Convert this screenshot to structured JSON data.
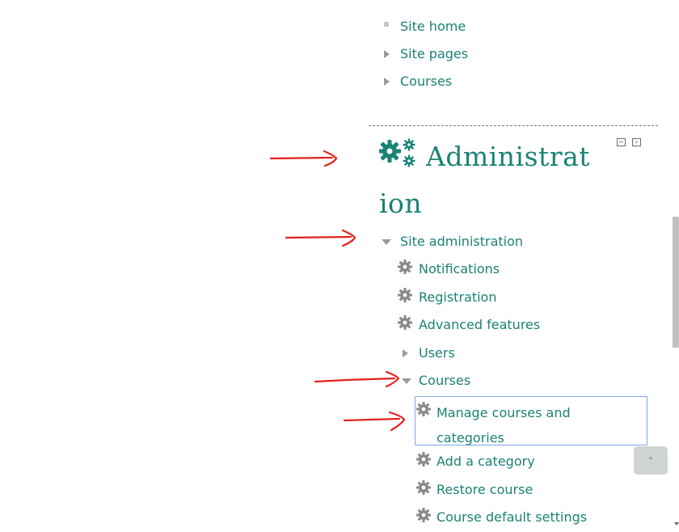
{
  "nav": {
    "site_home": "Site home",
    "site_pages": "Site pages",
    "courses": "Courses"
  },
  "admin_block": {
    "title_line1": "Administrat",
    "title_line2": "ion",
    "icon": "gears-icon",
    "controls": [
      "minimize-icon",
      "dock-icon"
    ]
  },
  "tree": {
    "site_administration": "Site administration",
    "notifications": "Notifications",
    "registration": "Registration",
    "advanced_features": "Advanced features",
    "users": "Users",
    "courses": "Courses",
    "manage_courses_line1": "Manage courses and",
    "manage_courses_line2": "categories",
    "add_category": "Add a category",
    "restore_course": "Restore course",
    "course_default_settings": "Course default settings"
  },
  "colors": {
    "link": "#1a8276",
    "annotation_arrow": "#e3221c",
    "focus_border": "#7aa7e8"
  },
  "annotations": {
    "arrow_count": 4
  }
}
